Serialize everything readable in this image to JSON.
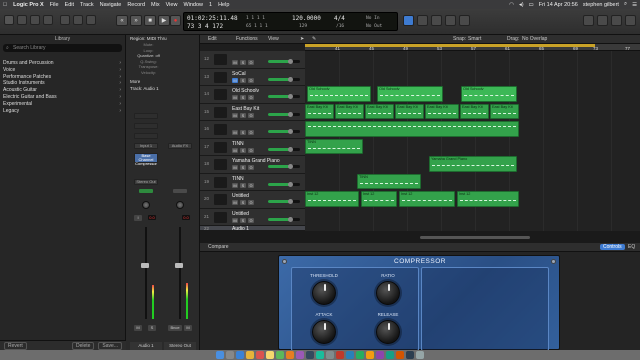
{
  "menubar": {
    "app": "Logic Pro X",
    "items": [
      "File",
      "Edit",
      "Track",
      "Navigate",
      "Record",
      "Mix",
      "View",
      "Window",
      "1",
      "Help"
    ],
    "date": "Fri 14 Apr 20:56",
    "user": "stephen gilbert"
  },
  "controlbar": {
    "position_bars": "01:02:25:11.48",
    "position_beats": "73  3  4  172",
    "bar_right_1": "1  1  1  1",
    "bar_right_2": "65  1  1  1",
    "tempo": "120.0000",
    "tempo_sub": "129",
    "time_sig": "4/4",
    "time_sig_sub": "/16",
    "in_label": "No In",
    "out_label": "No Out",
    "window_title": "sadsalsa 2017 - Tracks"
  },
  "library": {
    "title": "Library",
    "search_placeholder": "Search Library",
    "items": [
      "Drums and Percussion",
      "Voice",
      "Performance Patches",
      "Studio Instruments",
      "Acoustic Guitar",
      "Electric Guitar and Bass",
      "Experimental",
      "Legacy"
    ],
    "bottom": {
      "revert": "Revert",
      "delete": "Delete",
      "save": "Save..."
    }
  },
  "inspector": {
    "region_header": "Region: MIDI Thru",
    "region_rows": [
      "Mute:",
      "Loop:",
      "Quantize:",
      "Q-Swing:",
      "Transpose:",
      "Velocity:"
    ],
    "quantize_value": "off",
    "more": "More",
    "track_header": "Track: Audio 1",
    "strip1": {
      "input": "Input 1",
      "plugin": "Base Channel Compressor",
      "bus": "Stereo Out",
      "read": "Read",
      "vol": "0.0",
      "pan": "0.0",
      "name": "Audio 1"
    },
    "strip2": {
      "slot": "Audio FX",
      "read": "Read",
      "vol": "0.0",
      "pan": "0.0",
      "bounce": "Bnce",
      "name": "Stereo Out"
    }
  },
  "tracks_toolbar": {
    "edit": "Edit",
    "functions": "Functions",
    "view": "View",
    "snap_label": "Snap:",
    "snap_value": "Smart",
    "drag_label": "Drag:",
    "drag_value": "No Overlap"
  },
  "ruler": [
    "41",
    "45",
    "49",
    "53",
    "57",
    "61",
    "65",
    "69",
    "73",
    "77"
  ],
  "tracks": [
    {
      "num": "12",
      "name": "",
      "mute": false,
      "fader": 0.7
    },
    {
      "num": "13",
      "name": "SoCal",
      "mute": true,
      "fader": 0.7
    },
    {
      "num": "14",
      "name": "Old Schoolv",
      "mute": false,
      "fader": 0.7
    },
    {
      "num": "15",
      "name": "East Bay Kit",
      "mute": false,
      "fader": 0.7
    },
    {
      "num": "16",
      "name": "",
      "mute": false,
      "fader": 0.7
    },
    {
      "num": "17",
      "name": "TINN",
      "mute": false,
      "fader": 0.7
    },
    {
      "num": "18",
      "name": "Yamaha Grand Piano",
      "mute": false,
      "fader": 0.7
    },
    {
      "num": "19",
      "name": "TINN",
      "mute": false,
      "fader": 0.7
    },
    {
      "num": "20",
      "name": "Untitled",
      "mute": false,
      "fader": 0.7
    },
    {
      "num": "21",
      "name": "Untitled",
      "mute": false,
      "fader": 0.7
    },
    {
      "num": "22",
      "name": "Audio 1",
      "mute": false,
      "fader": 0.7
    }
  ],
  "regions": {
    "old_school_1": "Old Schoolv",
    "old_school_2": "Old Schoolv",
    "old_school_3": "Old Schoolv",
    "eastbay_1": "East Bay Kit",
    "eastbay_2": "East Bay Kit",
    "eastbay_3": "East Bay Kit",
    "eastbay_4": "East Bay Kit",
    "eastbay_5": "East Bay Kit",
    "eastbay_6": "East Bay Kit",
    "eastbay_7": "East Bay Kit",
    "tinn_1": "TINN",
    "piano": "Yamaha Grand Piano",
    "tinn_2": "TINN",
    "untitled_1": "Inst 12",
    "untitled_2": "Inst 12",
    "untitled_3": "Inst 12",
    "untitled_4": "Inst 12"
  },
  "editor": {
    "compare": "Compare",
    "tab_controls": "Controls",
    "tab_eq": "EQ",
    "plugin_title": "COMPRESSOR",
    "threshold": "THRESHOLD",
    "ratio": "RATIO",
    "attack": "ATTACK",
    "release": "RELEASE"
  },
  "colors": {
    "region_green": "#33a24b",
    "compressor_blue": "#2a4f85",
    "cycle_yellow": "#c9a227",
    "selected_blue": "#3e7bd1"
  }
}
